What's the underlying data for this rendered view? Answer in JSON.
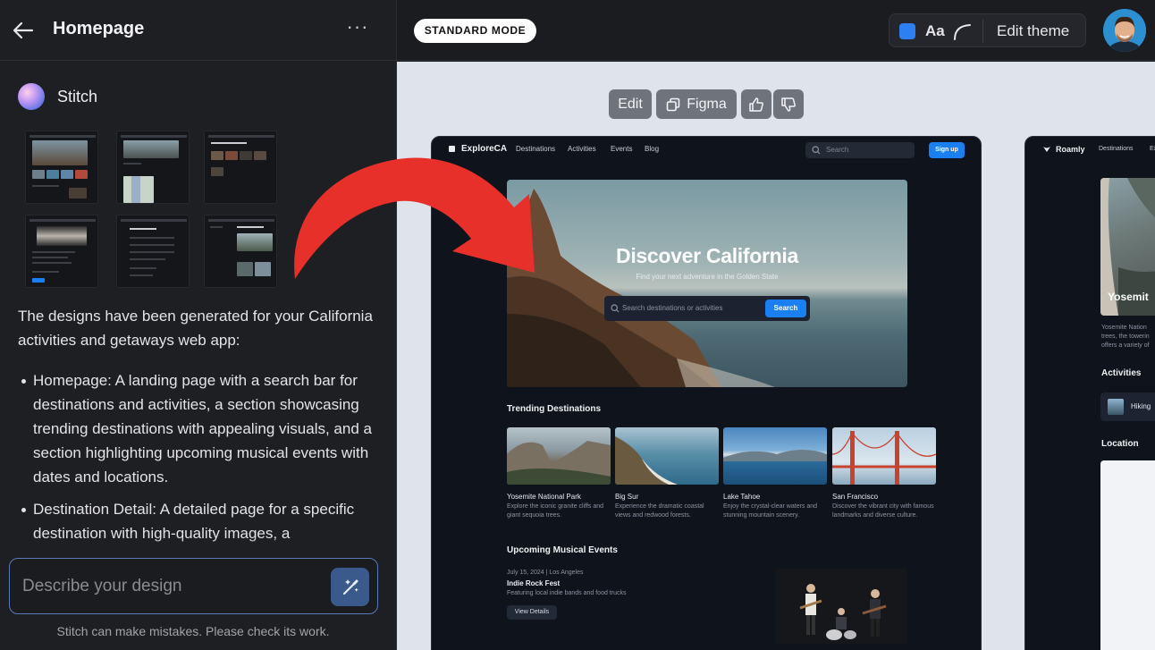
{
  "left_panel": {
    "title": "Homepage",
    "more_label": "···",
    "project_name": "Stitch",
    "message": "The designs have been generated for your California activities and getaways web app:",
    "bullets": [
      "Homepage: A landing page with a search bar for destinations and activities, a section showcasing trending destinations with appealing visuals, and a section highlighting upcoming musical events with dates and locations.",
      "Destination Detail: A detailed page for a specific destination with high-quality images, a"
    ],
    "prompt_placeholder": "Describe your design",
    "disclaimer": "Stitch can make mistakes. Please check its work."
  },
  "top_bar": {
    "mode": "STANDARD MODE",
    "theme_font_label": "Aa",
    "edit_theme_label": "Edit theme",
    "accent_color": "#2d7ff2"
  },
  "canvas_toolbar": {
    "edit_label": "Edit",
    "figma_label": "Figma"
  },
  "preview_main": {
    "brand": "ExploreCA",
    "nav": [
      "Destinations",
      "Activities",
      "Events",
      "Blog"
    ],
    "search_placeholder": "Search",
    "signup_label": "Sign up",
    "hero_title": "Discover California",
    "hero_subtitle": "Find your next adventure in the Golden State",
    "hero_search_placeholder": "Search destinations or activities",
    "hero_search_button": "Search",
    "trending_title": "Trending Destinations",
    "destinations": [
      {
        "name": "Yosemite National Park",
        "desc": "Explore the iconic granite cliffs and giant sequoia trees."
      },
      {
        "name": "Big Sur",
        "desc": "Experience the dramatic coastal views and redwood forests."
      },
      {
        "name": "Lake Tahoe",
        "desc": "Enjoy the crystal-clear waters and stunning mountain scenery."
      },
      {
        "name": "San Francisco",
        "desc": "Discover the vibrant city with famous landmarks and diverse culture."
      }
    ],
    "events_title": "Upcoming Musical Events",
    "event": {
      "date": "July 15, 2024 | Los Angeles",
      "name": "Indie Rock Fest",
      "desc": "Featuring local indie bands and food trucks",
      "button": "View Details"
    }
  },
  "preview_secondary": {
    "brand": "Roamly",
    "nav": [
      "Destinations",
      "Ex"
    ],
    "hero_title": "Yosemit",
    "desc_lines": [
      "Yosemite Nation",
      "trees, the towerin",
      "offers a variety of"
    ],
    "activities_title": "Activities",
    "activity_chip": "Hiking",
    "location_title": "Location"
  }
}
